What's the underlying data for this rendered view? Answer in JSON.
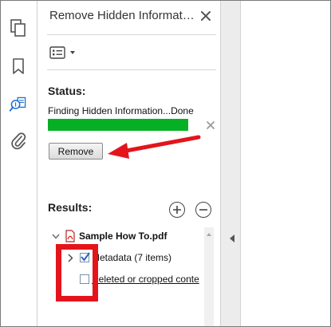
{
  "panel": {
    "title": "Remove Hidden Information",
    "status_label": "Status:",
    "status_text": "Finding Hidden Information...Done",
    "progress_fraction": 1.0,
    "remove_label": "Remove",
    "results_label": "Results:"
  },
  "tree": {
    "file": "Sample How To.pdf",
    "items": [
      {
        "label": "Metadata (7 items)",
        "checked": true
      },
      {
        "label": "Deleted or cropped conte",
        "checked": false
      }
    ]
  },
  "icons": {
    "leftbar": [
      "pages-icon",
      "bookmark-icon",
      "remove-hidden-info-icon",
      "attachment-icon"
    ],
    "options": "options-menu-icon",
    "add": "plus-icon",
    "remove": "minus-icon",
    "file": "pdf-file-icon"
  },
  "colors": {
    "progress": "#06b025",
    "annotation": "#e4141b",
    "checkbox_check": "#2a62c9"
  }
}
